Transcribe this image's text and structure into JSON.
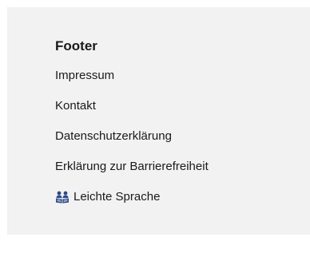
{
  "footer": {
    "heading": "Footer",
    "links": [
      {
        "label": "Impressum"
      },
      {
        "label": "Kontakt"
      },
      {
        "label": "Datenschutzerklärung"
      },
      {
        "label": "Erklärung zur Barrierefreiheit"
      },
      {
        "label": "Leichte Sprache",
        "icon": "easy-language-icon"
      }
    ]
  },
  "colors": {
    "panel_background": "#f2f2f2",
    "text": "#1a1a1a",
    "icon_blue": "#2d4a8a"
  }
}
